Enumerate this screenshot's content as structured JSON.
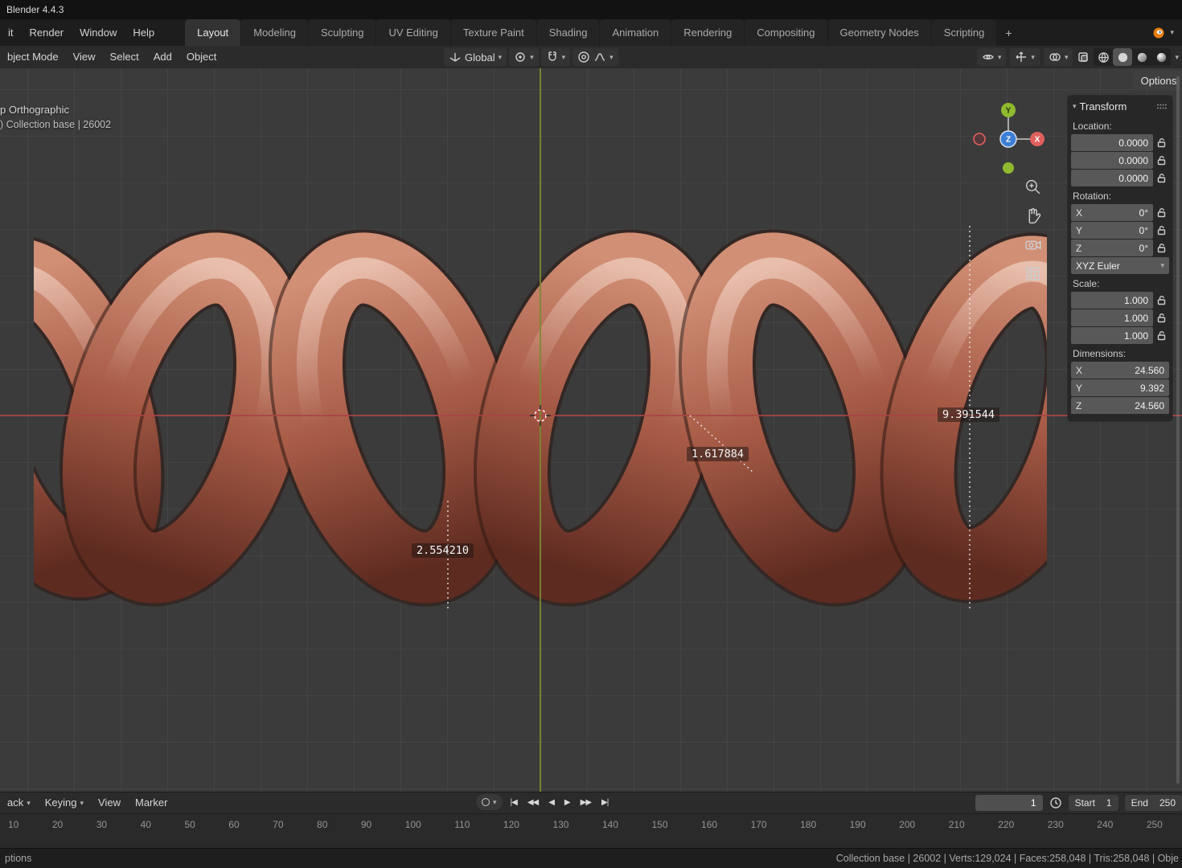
{
  "app": {
    "title": "Blender 4.4.3"
  },
  "topbar": {
    "menus": [
      "it",
      "Render",
      "Window",
      "Help"
    ],
    "tabs": [
      {
        "label": "Layout",
        "active": true
      },
      {
        "label": "Modeling"
      },
      {
        "label": "Sculpting"
      },
      {
        "label": "UV Editing"
      },
      {
        "label": "Texture Paint"
      },
      {
        "label": "Shading"
      },
      {
        "label": "Animation"
      },
      {
        "label": "Rendering"
      },
      {
        "label": "Compositing"
      },
      {
        "label": "Geometry Nodes"
      },
      {
        "label": "Scripting"
      }
    ],
    "new_tab": "+"
  },
  "toolbar": {
    "menus": [
      "bject Mode",
      "View",
      "Select",
      "Add",
      "Object"
    ],
    "orientation": "Global",
    "options_label": "Options"
  },
  "viewport": {
    "view_label": "p Orthographic",
    "collection_label": ") Collection base | 26002",
    "measurements": [
      {
        "value": "9.391544"
      },
      {
        "value": "1.617884"
      },
      {
        "value": "2.554210"
      }
    ],
    "gizmo": {
      "x": "X",
      "y": "Y",
      "z": "Z"
    }
  },
  "npanel": {
    "title": "Transform",
    "location": {
      "label": "Location:",
      "values": [
        "0.0000",
        "0.0000",
        "0.0000"
      ]
    },
    "rotation": {
      "label": "Rotation:",
      "rows": [
        {
          "axis": "X",
          "value": "0°"
        },
        {
          "axis": "Y",
          "value": "0°"
        },
        {
          "axis": "Z",
          "value": "0°"
        }
      ],
      "mode": "XYZ Euler"
    },
    "scale": {
      "label": "Scale:",
      "values": [
        "1.000",
        "1.000",
        "1.000"
      ]
    },
    "dimensions": {
      "label": "Dimensions:",
      "rows": [
        {
          "axis": "X",
          "value": "24.560"
        },
        {
          "axis": "Y",
          "value": "9.392"
        },
        {
          "axis": "Z",
          "value": "24.560"
        }
      ]
    }
  },
  "timeline": {
    "menus": [
      "ack",
      "Keying",
      "View",
      "Marker"
    ],
    "transport": {
      "jump_start": "|◀",
      "prev_key": "◀◀",
      "play_reverse": "◀",
      "play": "▶",
      "next_key": "▶▶",
      "jump_end": "▶|"
    },
    "current_frame": "1",
    "start": {
      "label": "Start",
      "value": "1"
    },
    "end": {
      "label": "End",
      "value": "250"
    },
    "ruler": [
      "10",
      "20",
      "30",
      "40",
      "50",
      "60",
      "70",
      "80",
      "90",
      "100",
      "110",
      "120",
      "130",
      "140",
      "150",
      "160",
      "170",
      "180",
      "190",
      "200",
      "210",
      "220",
      "230",
      "240",
      "250"
    ]
  },
  "statusbar": {
    "left": "ptions",
    "right": "Collection base | 26002 | Verts:129,024 | Faces:258,048 | Tris:258,048 | Obje"
  },
  "colors": {
    "object_light": "#d18f75",
    "object_mid": "#a65a46",
    "object_dark": "#5e2b20",
    "axis_x": "#a94444",
    "axis_y_line": "#7a8a33",
    "gizmo_x": "#e0605e",
    "gizmo_y": "#8fba2f",
    "gizmo_z": "#3d7fd6"
  }
}
